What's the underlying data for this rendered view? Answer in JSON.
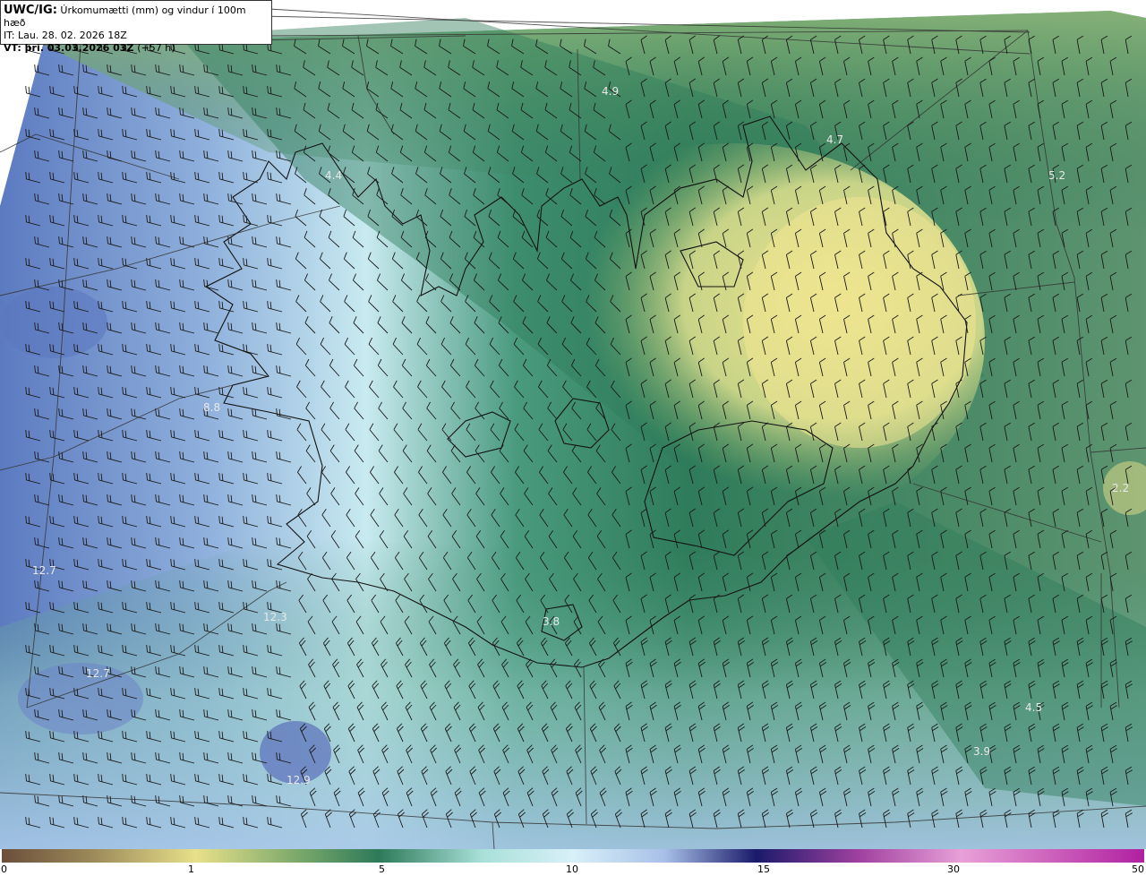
{
  "header": {
    "product": "UWC/IG:",
    "description": "Úrkomumætti (mm) og vindur í 100m hæð",
    "init_time": "IT: Lau. 28. 02. 2026 18Z",
    "valid_time": "VT: þri. 03.03.2026 03Z",
    "lead_time": "(+57 h)"
  },
  "colorbar": {
    "ticks": [
      "0",
      "1",
      "5",
      "10",
      "15",
      "30",
      "50"
    ],
    "colors": [
      "#6b4f3a",
      "#9c8a5a",
      "#e8e08a",
      "#7aa86a",
      "#2d7a5a",
      "#a8e0d8",
      "#d8f0f8",
      "#a8c0e8",
      "#5060b8",
      "#1a1a6a",
      "#a040a0",
      "#e8a0d8",
      "#b020a0"
    ]
  },
  "map": {
    "land_color": "#e8e08a",
    "sea_color": "#2d7a5a",
    "values": [
      {
        "label": "4.9"
      },
      {
        "label": "4.7"
      },
      {
        "label": "5.2"
      },
      {
        "label": "4.4"
      },
      {
        "label": "8.8"
      },
      {
        "label": "12.7"
      },
      {
        "label": "12.3"
      },
      {
        "label": "12.7"
      },
      {
        "label": "3.8"
      },
      {
        "label": "12.9"
      },
      {
        "label": "4.5"
      },
      {
        "label": "3.9"
      },
      {
        "label": "2.2"
      }
    ]
  }
}
